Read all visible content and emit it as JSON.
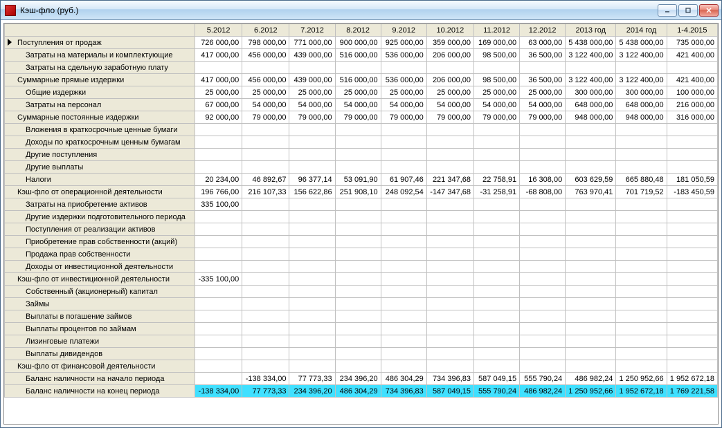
{
  "window": {
    "title": "Кэш-фло (руб.)"
  },
  "columns": [
    "5.2012",
    "6.2012",
    "7.2012",
    "8.2012",
    "9.2012",
    "10.2012",
    "11.2012",
    "12.2012",
    "2013 год",
    "2014 год",
    "1-4.2015"
  ],
  "rows": [
    {
      "label": "Поступления от продаж",
      "indent": false,
      "pointer": true,
      "highlight": false,
      "cells": [
        "726 000,00",
        "798 000,00",
        "771 000,00",
        "900 000,00",
        "925 000,00",
        "359 000,00",
        "169 000,00",
        "63 000,00",
        "5 438 000,00",
        "5 438 000,00",
        "735 000,00"
      ]
    },
    {
      "label": "Затраты на материалы и комплектующие",
      "indent": true,
      "pointer": false,
      "highlight": false,
      "cells": [
        "417 000,00",
        "456 000,00",
        "439 000,00",
        "516 000,00",
        "536 000,00",
        "206 000,00",
        "98 500,00",
        "36 500,00",
        "3 122 400,00",
        "3 122 400,00",
        "421 400,00"
      ]
    },
    {
      "label": "Затраты на сдельную заработную плату",
      "indent": true,
      "pointer": false,
      "highlight": false,
      "cells": [
        "",
        "",
        "",
        "",
        "",
        "",
        "",
        "",
        "",
        "",
        ""
      ]
    },
    {
      "label": "Суммарные прямые издержки",
      "indent": false,
      "pointer": false,
      "highlight": false,
      "cells": [
        "417 000,00",
        "456 000,00",
        "439 000,00",
        "516 000,00",
        "536 000,00",
        "206 000,00",
        "98 500,00",
        "36 500,00",
        "3 122 400,00",
        "3 122 400,00",
        "421 400,00"
      ]
    },
    {
      "label": "Общие издержки",
      "indent": true,
      "pointer": false,
      "highlight": false,
      "cells": [
        "25 000,00",
        "25 000,00",
        "25 000,00",
        "25 000,00",
        "25 000,00",
        "25 000,00",
        "25 000,00",
        "25 000,00",
        "300 000,00",
        "300 000,00",
        "100 000,00"
      ]
    },
    {
      "label": "Затраты на персонал",
      "indent": true,
      "pointer": false,
      "highlight": false,
      "cells": [
        "67 000,00",
        "54 000,00",
        "54 000,00",
        "54 000,00",
        "54 000,00",
        "54 000,00",
        "54 000,00",
        "54 000,00",
        "648 000,00",
        "648 000,00",
        "216 000,00"
      ]
    },
    {
      "label": "Суммарные постоянные издержки",
      "indent": false,
      "pointer": false,
      "highlight": false,
      "cells": [
        "92 000,00",
        "79 000,00",
        "79 000,00",
        "79 000,00",
        "79 000,00",
        "79 000,00",
        "79 000,00",
        "79 000,00",
        "948 000,00",
        "948 000,00",
        "316 000,00"
      ]
    },
    {
      "label": "Вложения в краткосрочные ценные бумаги",
      "indent": true,
      "pointer": false,
      "highlight": false,
      "cells": [
        "",
        "",
        "",
        "",
        "",
        "",
        "",
        "",
        "",
        "",
        ""
      ]
    },
    {
      "label": "Доходы по краткосрочным ценным бумагам",
      "indent": true,
      "pointer": false,
      "highlight": false,
      "cells": [
        "",
        "",
        "",
        "",
        "",
        "",
        "",
        "",
        "",
        "",
        ""
      ]
    },
    {
      "label": "Другие поступления",
      "indent": true,
      "pointer": false,
      "highlight": false,
      "cells": [
        "",
        "",
        "",
        "",
        "",
        "",
        "",
        "",
        "",
        "",
        ""
      ]
    },
    {
      "label": "Другие выплаты",
      "indent": true,
      "pointer": false,
      "highlight": false,
      "cells": [
        "",
        "",
        "",
        "",
        "",
        "",
        "",
        "",
        "",
        "",
        ""
      ]
    },
    {
      "label": "Налоги",
      "indent": true,
      "pointer": false,
      "highlight": false,
      "cells": [
        "20 234,00",
        "46 892,67",
        "96 377,14",
        "53 091,90",
        "61 907,46",
        "221 347,68",
        "22 758,91",
        "16 308,00",
        "603 629,59",
        "665 880,48",
        "181 050,59"
      ]
    },
    {
      "label": "Кэш-фло от операционной деятельности",
      "indent": false,
      "pointer": false,
      "highlight": false,
      "cells": [
        "196 766,00",
        "216 107,33",
        "156 622,86",
        "251 908,10",
        "248 092,54",
        "-147 347,68",
        "-31 258,91",
        "-68 808,00",
        "763 970,41",
        "701 719,52",
        "-183 450,59"
      ]
    },
    {
      "label": "Затраты на приобретение активов",
      "indent": true,
      "pointer": false,
      "highlight": false,
      "cells": [
        "335 100,00",
        "",
        "",
        "",
        "",
        "",
        "",
        "",
        "",
        "",
        ""
      ]
    },
    {
      "label": "Другие издержки подготовительного периода",
      "indent": true,
      "pointer": false,
      "highlight": false,
      "cells": [
        "",
        "",
        "",
        "",
        "",
        "",
        "",
        "",
        "",
        "",
        ""
      ]
    },
    {
      "label": "Поступления от реализации активов",
      "indent": true,
      "pointer": false,
      "highlight": false,
      "cells": [
        "",
        "",
        "",
        "",
        "",
        "",
        "",
        "",
        "",
        "",
        ""
      ]
    },
    {
      "label": "Приобретение прав собственности (акций)",
      "indent": true,
      "pointer": false,
      "highlight": false,
      "cells": [
        "",
        "",
        "",
        "",
        "",
        "",
        "",
        "",
        "",
        "",
        ""
      ]
    },
    {
      "label": "Продажа прав собственности",
      "indent": true,
      "pointer": false,
      "highlight": false,
      "cells": [
        "",
        "",
        "",
        "",
        "",
        "",
        "",
        "",
        "",
        "",
        ""
      ]
    },
    {
      "label": "Доходы от инвестиционной деятельности",
      "indent": true,
      "pointer": false,
      "highlight": false,
      "cells": [
        "",
        "",
        "",
        "",
        "",
        "",
        "",
        "",
        "",
        "",
        ""
      ]
    },
    {
      "label": "Кэш-фло от инвестиционной деятельности",
      "indent": false,
      "pointer": false,
      "highlight": false,
      "cells": [
        "-335 100,00",
        "",
        "",
        "",
        "",
        "",
        "",
        "",
        "",
        "",
        ""
      ]
    },
    {
      "label": "Собственный (акционерный) капитал",
      "indent": true,
      "pointer": false,
      "highlight": false,
      "cells": [
        "",
        "",
        "",
        "",
        "",
        "",
        "",
        "",
        "",
        "",
        ""
      ]
    },
    {
      "label": "Займы",
      "indent": true,
      "pointer": false,
      "highlight": false,
      "cells": [
        "",
        "",
        "",
        "",
        "",
        "",
        "",
        "",
        "",
        "",
        ""
      ]
    },
    {
      "label": "Выплаты в погашение займов",
      "indent": true,
      "pointer": false,
      "highlight": false,
      "cells": [
        "",
        "",
        "",
        "",
        "",
        "",
        "",
        "",
        "",
        "",
        ""
      ]
    },
    {
      "label": "Выплаты процентов по займам",
      "indent": true,
      "pointer": false,
      "highlight": false,
      "cells": [
        "",
        "",
        "",
        "",
        "",
        "",
        "",
        "",
        "",
        "",
        ""
      ]
    },
    {
      "label": "Лизинговые платежи",
      "indent": true,
      "pointer": false,
      "highlight": false,
      "cells": [
        "",
        "",
        "",
        "",
        "",
        "",
        "",
        "",
        "",
        "",
        ""
      ]
    },
    {
      "label": "Выплаты дивидендов",
      "indent": true,
      "pointer": false,
      "highlight": false,
      "cells": [
        "",
        "",
        "",
        "",
        "",
        "",
        "",
        "",
        "",
        "",
        ""
      ]
    },
    {
      "label": "Кэш-фло от финансовой деятельности",
      "indent": false,
      "pointer": false,
      "highlight": false,
      "cells": [
        "",
        "",
        "",
        "",
        "",
        "",
        "",
        "",
        "",
        "",
        ""
      ]
    },
    {
      "label": "Баланс наличности на начало периода",
      "indent": true,
      "pointer": false,
      "highlight": false,
      "cells": [
        "",
        "-138 334,00",
        "77 773,33",
        "234 396,20",
        "486 304,29",
        "734 396,83",
        "587 049,15",
        "555 790,24",
        "486 982,24",
        "1 250 952,66",
        "1 952 672,18"
      ]
    },
    {
      "label": "Баланс наличности на конец периода",
      "indent": true,
      "pointer": false,
      "highlight": true,
      "cells": [
        "-138 334,00",
        "77 773,33",
        "234 396,20",
        "486 304,29",
        "734 396,83",
        "587 049,15",
        "555 790,24",
        "486 982,24",
        "1 250 952,66",
        "1 952 672,18",
        "1 769 221,58"
      ]
    }
  ]
}
